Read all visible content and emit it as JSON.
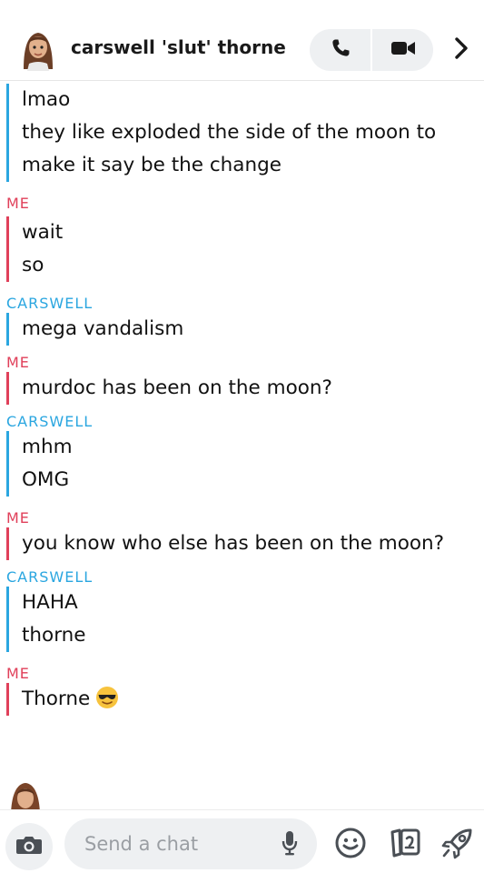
{
  "header": {
    "contact_name": "carswell 'slut' thorne",
    "icons": {
      "avatar": "bitmoji-avatar",
      "voice_call": "phone-icon",
      "video_call": "video-camera-icon",
      "more": "chevron-right-icon"
    }
  },
  "colors": {
    "me": "#e0405a",
    "them": "#2aa6e0",
    "pill_bg": "#eef0f2"
  },
  "conversation": [
    {
      "sender": "",
      "who": "them",
      "lines": [
        "lmao",
        "they like exploded the side of the moon to",
        "make it say be the change"
      ]
    },
    {
      "sender": "ME",
      "who": "me",
      "lines": [
        "wait",
        "so"
      ]
    },
    {
      "sender": "CARSWELL",
      "who": "them",
      "lines": [
        "mega vandalism"
      ]
    },
    {
      "sender": "ME",
      "who": "me",
      "lines": [
        "murdoc has been on the moon?"
      ]
    },
    {
      "sender": "CARSWELL",
      "who": "them",
      "lines": [
        "mhm",
        "OMG"
      ]
    },
    {
      "sender": "ME",
      "who": "me",
      "lines": [
        "you know who else has been on the moon?"
      ]
    },
    {
      "sender": "CARSWELL",
      "who": "them",
      "lines": [
        "HAHA",
        "thorne"
      ]
    },
    {
      "sender": "ME",
      "who": "me",
      "lines": [
        "Thorne"
      ],
      "emoji": "sunglasses-face"
    }
  ],
  "composer": {
    "placeholder": "Send a chat",
    "value": "",
    "icons": {
      "camera": "camera-icon",
      "mic": "microphone-icon",
      "emoji": "smiley-icon",
      "stickers": "sticker-icon",
      "games": "rocket-icon"
    }
  }
}
